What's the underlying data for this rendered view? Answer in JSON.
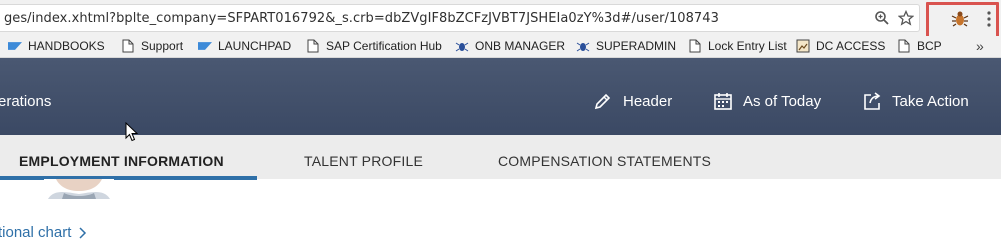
{
  "browser": {
    "url": "ges/index.xhtml?bplte_company=SFPART016792&_s.crb=dbZVgIF8bZCFzJVBT7JSHEIa0zY%3d#/user/108743",
    "icons": [
      "zoom-icon",
      "star-icon",
      "bug-extension-icon",
      "menu-dots-icon"
    ]
  },
  "bookmarks": [
    {
      "label": "HANDBOOKS",
      "icon": "sap-icon"
    },
    {
      "label": "Support",
      "icon": "page-icon"
    },
    {
      "label": "LAUNCHPAD",
      "icon": "sap-icon"
    },
    {
      "label": "SAP Certification Hub",
      "icon": "page-icon"
    },
    {
      "label": "ONB MANAGER",
      "icon": "spider-icon"
    },
    {
      "label": "SUPERADMIN",
      "icon": "spider-icon"
    },
    {
      "label": "Lock Entry List",
      "icon": "page-icon"
    },
    {
      "label": "DC ACCESS",
      "icon": "image-icon"
    },
    {
      "label": "BCP",
      "icon": "page-icon"
    }
  ],
  "bookmarks_more": "»",
  "header": {
    "crumb": "erations",
    "actions": [
      {
        "label": "Header",
        "icon": "pencil-icon"
      },
      {
        "label": "As of Today",
        "icon": "calendar-icon"
      },
      {
        "label": "Take Action",
        "icon": "share-icon"
      }
    ]
  },
  "tabs": [
    {
      "label": "EMPLOYMENT INFORMATION",
      "active": true
    },
    {
      "label": "TALENT PROFILE",
      "active": false
    },
    {
      "label": "COMPENSATION STATEMENTS",
      "active": false
    }
  ],
  "content": {
    "org_link": "tional chart",
    "org_link_icon": "chevron-right-icon"
  },
  "colors": {
    "header_bg": "#414f6b",
    "accent": "#2f70a8",
    "highlight_box": "#d9534f"
  }
}
